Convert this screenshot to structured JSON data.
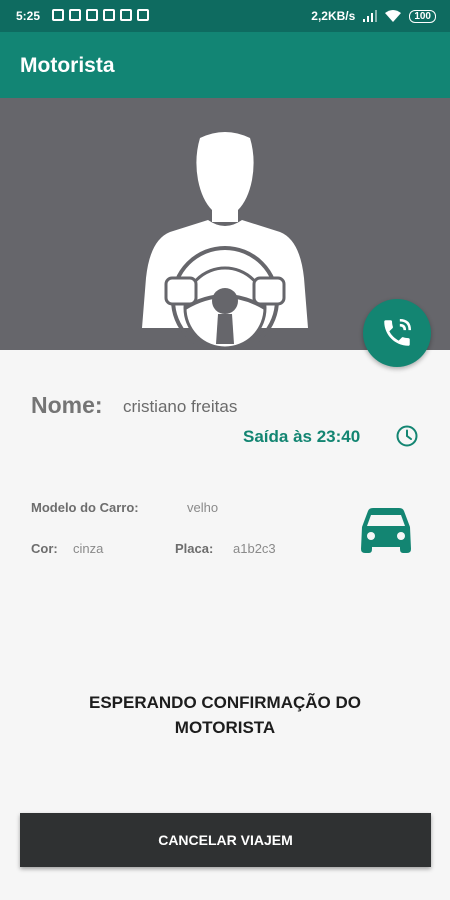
{
  "status_bar": {
    "time": "5:25",
    "network_speed": "2,2KB/s",
    "battery": "100"
  },
  "app_bar": {
    "title": "Motorista"
  },
  "driver": {
    "name_label": "Nome:",
    "name_value": "cristiano freitas",
    "departure": "Saída às 23:40",
    "car_model_label": "Modelo do Carro:",
    "car_model_value": "velho",
    "color_label": "Cor:",
    "color_value": "cinza",
    "plate_label": "Placa:",
    "plate_value": "a1b2c3"
  },
  "status_message": {
    "line1": "ESPERANDO CONFIRMAÇÃO DO",
    "line2": "MOTORISTA"
  },
  "cancel_button": {
    "label": "CANCELAR VIAJEM"
  },
  "colors": {
    "primary": "#128574",
    "primary_dark": "#0e6b60",
    "hero_bg": "#66666b",
    "button_bg": "#2f3132"
  },
  "icons": {
    "hero": "driver-avatar-icon",
    "fab": "phone-call-icon",
    "departure": "clock-icon",
    "car": "car-icon"
  }
}
